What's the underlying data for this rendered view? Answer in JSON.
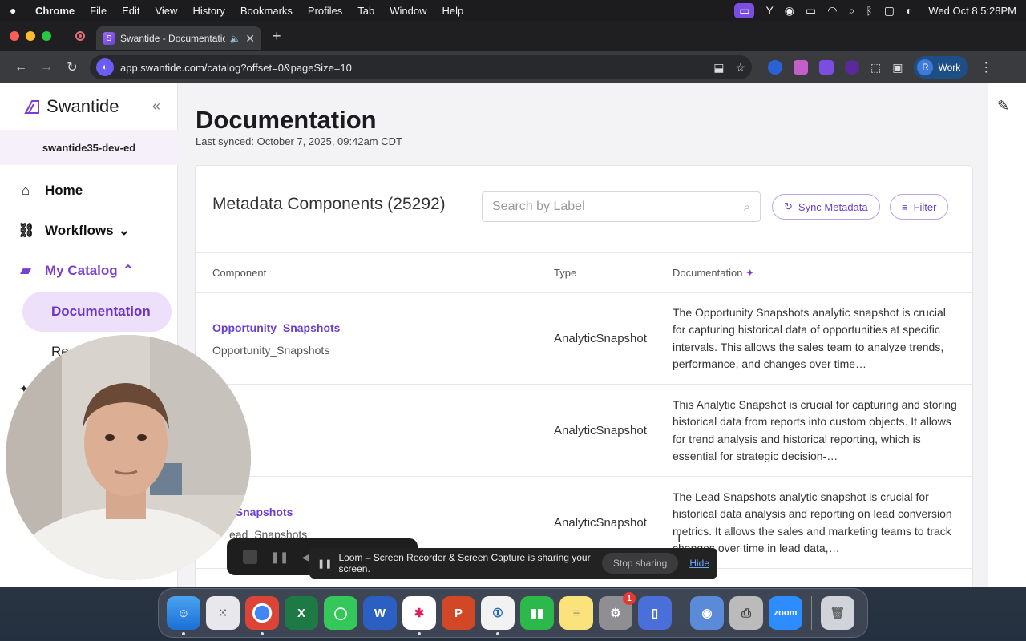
{
  "menubar": {
    "app": "Chrome",
    "items": [
      "File",
      "Edit",
      "View",
      "History",
      "Bookmarks",
      "Profiles",
      "Tab",
      "Window",
      "Help"
    ],
    "clock": "Wed Oct 8  5:28PM"
  },
  "browser": {
    "tab_title": "Swantide - Documentation",
    "url": "app.swantide.com/catalog?offset=0&pageSize=10",
    "profile_initial": "R",
    "profile_label": "Work"
  },
  "sidebar": {
    "brand": "Swantide",
    "org": "swantide35-dev-ed",
    "items": [
      {
        "label": "Home",
        "icon": "home-icon"
      },
      {
        "label": "Workflows",
        "icon": "workflow-icon",
        "chevron": "⌄"
      },
      {
        "label": "My Catalog",
        "icon": "folder-icon",
        "chevron": "⌃"
      }
    ],
    "sub_active": "Documentation",
    "sub_partial": "Re",
    "star_partial": "✦"
  },
  "page": {
    "title": "Documentation",
    "last_synced": "Last synced: October 7, 2025, 09:42am CDT"
  },
  "card": {
    "title": "Metadata Components (25292)",
    "search_placeholder": "Search by Label",
    "sync_button": "Sync Metadata",
    "filter_button": "Filter",
    "columns": {
      "component": "Component",
      "type": "Type",
      "documentation": "Documentation"
    }
  },
  "rows": [
    {
      "label": "Opportunity_Snapshots",
      "api_name": "Opportunity_Snapshots",
      "type": "AnalyticSnapshot",
      "doc": "The Opportunity Snapshots analytic snapshot is crucial for capturing historical data of opportunities at specific intervals. This allows the sales team to analyze trends, performance, and changes over time…"
    },
    {
      "label": "",
      "api_name": "",
      "type": "AnalyticSnapshot",
      "doc": "This Analytic Snapshot is crucial for capturing and storing historical data from reports into custom objects. It allows for trend analysis and historical reporting, which is essential for strategic decision-…"
    },
    {
      "label": "_Snapshots",
      "api_name": "ead_Snapshots",
      "type": "AnalyticSnapshot",
      "doc": "The Lead Snapshots analytic snapshot is crucial for historical data analysis and reporting on lead conversion metrics. It allows the sales and marketing teams to track changes over time in lead data,…"
    }
  ],
  "loom": {
    "message": "Loom – Screen Recorder & Screen Capture is sharing your screen.",
    "stop": "Stop sharing",
    "hide": "Hide"
  },
  "dock": {
    "numbers_badge": "1",
    "zoom_label": "zoom"
  }
}
